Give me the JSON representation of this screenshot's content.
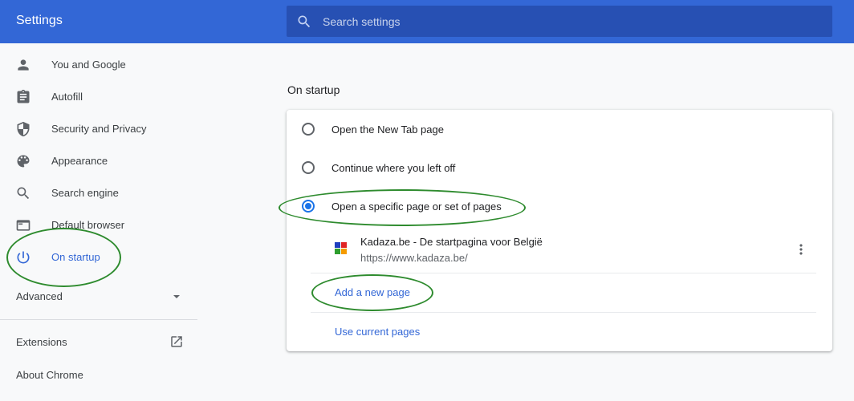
{
  "header": {
    "title": "Settings",
    "search_placeholder": "Search settings"
  },
  "sidebar": {
    "items": [
      {
        "label": "You and Google",
        "icon": "person-icon"
      },
      {
        "label": "Autofill",
        "icon": "clipboard-icon"
      },
      {
        "label": "Security and Privacy",
        "icon": "shield-icon"
      },
      {
        "label": "Appearance",
        "icon": "palette-icon"
      },
      {
        "label": "Search engine",
        "icon": "search-icon"
      },
      {
        "label": "Default browser",
        "icon": "browser-window-icon"
      },
      {
        "label": "On startup",
        "icon": "power-icon",
        "active": true
      }
    ],
    "advanced_label": "Advanced",
    "extensions_label": "Extensions",
    "about_label": "About Chrome"
  },
  "main": {
    "section_title": "On startup",
    "options": [
      {
        "label": "Open the New Tab page",
        "selected": false
      },
      {
        "label": "Continue where you left off",
        "selected": false
      },
      {
        "label": "Open a specific page or set of pages",
        "selected": true
      }
    ],
    "pages": [
      {
        "title": "Kadaza.be - De startpagina voor België",
        "url": "https://www.kadaza.be/"
      }
    ],
    "add_page_label": "Add a new page",
    "use_current_label": "Use current pages"
  },
  "colors": {
    "header": "#3367d6",
    "accent": "#1a73e8",
    "annotation": "#2e8b2e"
  }
}
